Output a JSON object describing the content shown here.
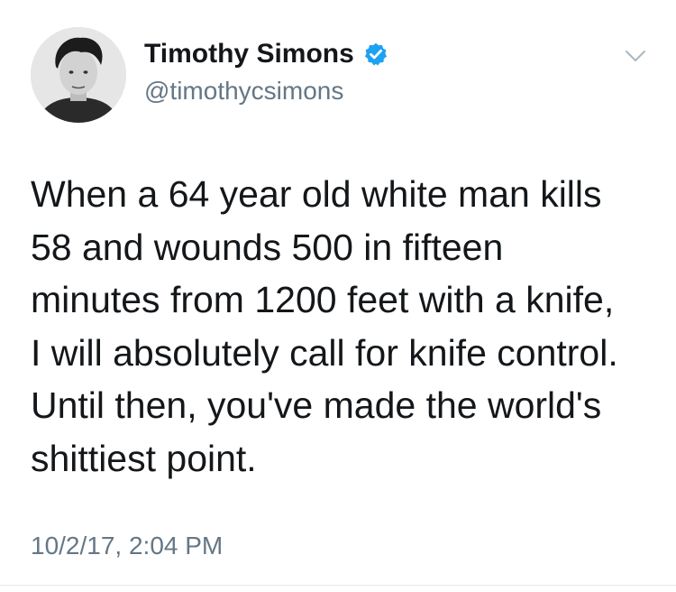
{
  "tweet": {
    "author": {
      "display_name": "Timothy Simons",
      "handle": "@timothycsimons",
      "verified": true,
      "avatar_icon": "profile-photo"
    },
    "text_lines": [
      "When a 64 year old white man kills",
      "58 and wounds 500 in fifteen",
      "minutes from 1200 feet with a knife,",
      "I will absolutely call for knife control.",
      "Until then, you've made the world's",
      "shittiest point."
    ],
    "timestamp": "10/2/17, 2:04 PM"
  },
  "colors": {
    "text": "#14171a",
    "secondary_text": "#657786",
    "verified_badge": "#1da1f2",
    "divider": "#e1e8ed"
  },
  "icons": {
    "verified": "verified-badge-icon",
    "menu": "chevron-down-icon"
  }
}
